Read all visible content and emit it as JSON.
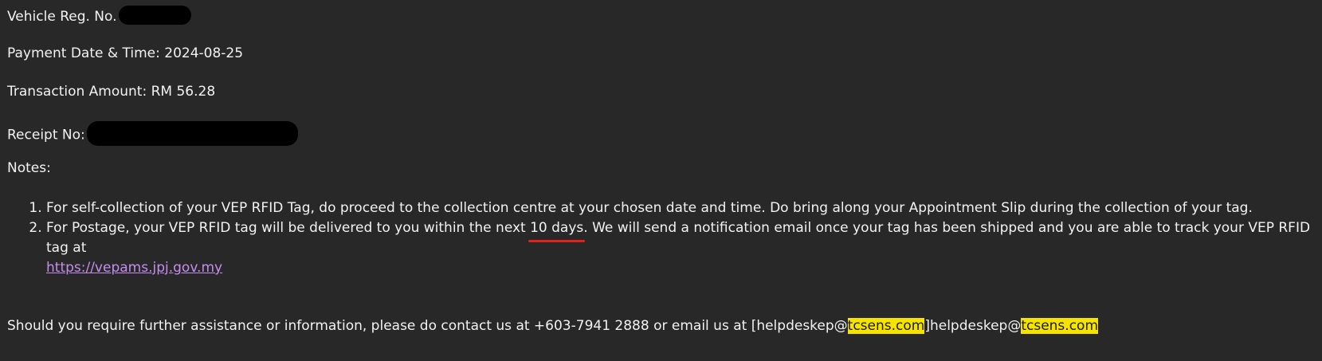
{
  "vehicle": {
    "label": "Vehicle Reg. No."
  },
  "payment": {
    "label": "Payment Date & Time: 2024-08-25"
  },
  "amount": {
    "label": "Transaction Amount: RM 56.28"
  },
  "receipt": {
    "label": "Receipt No:"
  },
  "notes": {
    "heading": "Notes:",
    "item1": "For self-collection of your VEP RFID Tag, do proceed to the collection centre at your chosen date and time. Do bring along your Appointment Slip during the collection of your tag.",
    "item2_before": "For Postage, your VEP RFID tag will be delivered to you within the next ",
    "item2_highlight": "10 days",
    "item2_after": ". We will send a notification email once your tag has been shipped and you are able to track your VEP RFID tag at",
    "item2_link": "https://vepams.jpj.gov.my"
  },
  "footer": {
    "text": "Should you require further assistance or information, please do contact us at +603-7941 2888 or email us at [helpdeskep@",
    "hl1": "tcsens.com",
    "mid": "]helpdeskep@",
    "hl2": "tcsens.com"
  },
  "colors": {
    "background": "#282828",
    "text": "#f2f2f2",
    "link": "#c58df0",
    "highlight": "#f6e400",
    "underline": "#e0221b"
  }
}
